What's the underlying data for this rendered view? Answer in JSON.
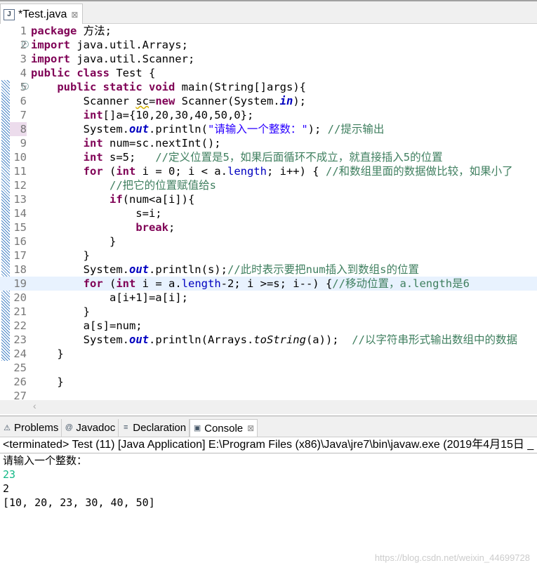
{
  "editor_tab": {
    "title": "*Test.java",
    "close": "⊠"
  },
  "highlight_line": 19,
  "marked_line": 8,
  "code": [
    [
      [
        "package",
        "kw"
      ],
      [
        " 方法;",
        ""
      ]
    ],
    [
      [
        "import",
        "kw"
      ],
      [
        " java.util.Arrays;",
        ""
      ]
    ],
    [
      [
        "import",
        "kw"
      ],
      [
        " java.util.Scanner;",
        ""
      ]
    ],
    [
      [
        "public",
        "kw"
      ],
      [
        " ",
        ""
      ],
      [
        "class",
        "kw"
      ],
      [
        " Test {",
        ""
      ]
    ],
    [
      [
        "    ",
        ""
      ],
      [
        "public",
        "kw"
      ],
      [
        " ",
        ""
      ],
      [
        "static",
        "kw"
      ],
      [
        " ",
        ""
      ],
      [
        "void",
        "kw"
      ],
      [
        " main(String[]args){",
        ""
      ]
    ],
    [
      [
        "        Scanner ",
        ""
      ],
      [
        "sc",
        "warn"
      ],
      [
        "=",
        ""
      ],
      [
        "new",
        "kw"
      ],
      [
        " Scanner(System.",
        ""
      ],
      [
        "in",
        "fld"
      ],
      [
        ");",
        ""
      ]
    ],
    [
      [
        "        ",
        ""
      ],
      [
        "int",
        "kw"
      ],
      [
        "[]a={10,20,30,40,50,0};",
        ""
      ]
    ],
    [
      [
        "        System.",
        ""
      ],
      [
        "out",
        "fld"
      ],
      [
        ".println(",
        ""
      ],
      [
        "\"请输入一个整数：\"",
        "str"
      ],
      [
        "); ",
        ""
      ],
      [
        "//提示输出",
        "cm"
      ]
    ],
    [
      [
        "        ",
        ""
      ],
      [
        "int",
        "kw"
      ],
      [
        " num=sc.nextInt();",
        ""
      ]
    ],
    [
      [
        "        ",
        ""
      ],
      [
        "int",
        "kw"
      ],
      [
        " s=5;   ",
        ""
      ],
      [
        "//定义位置是5，如果后面循环不成立，就直接插入5的位置",
        "cm"
      ]
    ],
    [
      [
        "        ",
        ""
      ],
      [
        "for",
        "kw"
      ],
      [
        " (",
        ""
      ],
      [
        "int",
        "kw"
      ],
      [
        " i = 0; i < a.",
        ""
      ],
      [
        "length",
        "fn"
      ],
      [
        "; i++) { ",
        ""
      ],
      [
        "//和数组里面的数据做比较，如果小了",
        "cm"
      ]
    ],
    [
      [
        "            ",
        ""
      ],
      [
        "//把它的位置赋值给s",
        "cm"
      ]
    ],
    [
      [
        "            ",
        ""
      ],
      [
        "if",
        "kw"
      ],
      [
        "(num<a[i]){",
        ""
      ]
    ],
    [
      [
        "                s=i;",
        ""
      ]
    ],
    [
      [
        "                ",
        ""
      ],
      [
        "break",
        "kw"
      ],
      [
        ";",
        ""
      ]
    ],
    [
      [
        "            }",
        ""
      ]
    ],
    [
      [
        "        }",
        ""
      ]
    ],
    [
      [
        "        System.",
        ""
      ],
      [
        "out",
        "fld"
      ],
      [
        ".println(s);",
        ""
      ],
      [
        "//此时表示要把num插入到数组s的位置",
        "cm"
      ]
    ],
    [
      [
        "        ",
        ""
      ],
      [
        "for",
        "kw"
      ],
      [
        " (",
        ""
      ],
      [
        "int",
        "kw"
      ],
      [
        " i = a.",
        ""
      ],
      [
        "length",
        "fn"
      ],
      [
        "-2; i >=s; i--) {",
        ""
      ],
      [
        "//移动位置，a.length是6",
        "cm"
      ]
    ],
    [
      [
        "            a[i+1]=a[i];",
        ""
      ]
    ],
    [
      [
        "        }",
        ""
      ]
    ],
    [
      [
        "        a[s]=num;",
        ""
      ]
    ],
    [
      [
        "        System.",
        ""
      ],
      [
        "out",
        "fld"
      ],
      [
        ".println(Arrays.",
        ""
      ],
      [
        "toString",
        "it"
      ],
      [
        "(a));  ",
        ""
      ],
      [
        "//以字符串形式输出数组中的数据",
        "cm"
      ]
    ],
    [
      [
        "    }",
        ""
      ]
    ],
    [],
    [
      [
        "    }",
        ""
      ]
    ],
    []
  ],
  "scroll_left": "‹",
  "console_tabs": [
    {
      "label": "Problems",
      "icon": "problems-icon",
      "glyph": "⚠"
    },
    {
      "label": "Javadoc",
      "icon": "at-icon",
      "glyph": "@"
    },
    {
      "label": "Declaration",
      "icon": "declaration-icon",
      "glyph": "≡"
    },
    {
      "label": "Console",
      "icon": "console-icon",
      "glyph": "▣",
      "close": "⊠"
    }
  ],
  "console": {
    "status": "<terminated> Test (11) [Java Application] E:\\Program Files (x86)\\Java\\jre7\\bin\\javaw.exe (2019年4月15日 _",
    "lines": [
      {
        "text": "请输入一个整数：",
        "type": "out"
      },
      {
        "text": "23",
        "type": "in"
      },
      {
        "text": "2",
        "type": "out"
      },
      {
        "text": "[10, 20, 23, 30, 40, 50]",
        "type": "out"
      }
    ]
  },
  "watermark": "https://blog.csdn.net/weixin_44699728"
}
